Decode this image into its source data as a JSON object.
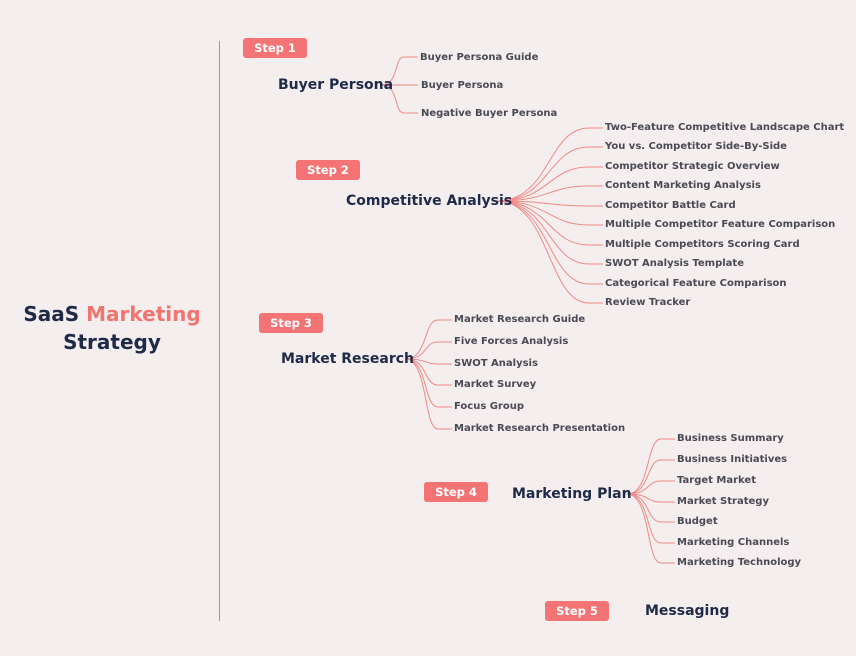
{
  "title": {
    "part1": "SaaS",
    "part2": "Marketing",
    "part3": "Strategy"
  },
  "colors": {
    "accent": "#f47374",
    "branch": "#f08a86",
    "text": "#1e2a47",
    "leaf_text": "#4a4a55"
  },
  "steps": [
    {
      "badge": "Step 1",
      "label": "Buyer Persona",
      "items": [
        "Buyer Persona Guide",
        "Buyer Persona",
        "Negative Buyer Persona"
      ]
    },
    {
      "badge": "Step 2",
      "label": "Competitive Analysis",
      "items": [
        "Two-Feature Competitive Landscape Chart",
        "You vs. Competitor Side-By-Side",
        "Competitor Strategic Overview",
        "Content Marketing Analysis",
        "Competitor Battle Card",
        "Multiple Competitor Feature Comparison",
        "Multiple Competitors Scoring Card",
        "SWOT Analysis Template",
        "Categorical Feature Comparison",
        "Review Tracker"
      ]
    },
    {
      "badge": "Step 3",
      "label": "Market Research",
      "items": [
        "Market Research Guide",
        "Five Forces Analysis",
        "SWOT Analysis",
        "Market Survey",
        "Focus Group",
        "Market Research Presentation"
      ]
    },
    {
      "badge": "Step 4",
      "label": "Marketing Plan",
      "items": [
        "Business Summary",
        "Business Initiatives",
        "Target Market",
        "Market Strategy",
        "Budget",
        "Marketing Channels",
        "Marketing Technology"
      ]
    },
    {
      "badge": "Step 5",
      "label": "Messaging",
      "items": []
    }
  ]
}
